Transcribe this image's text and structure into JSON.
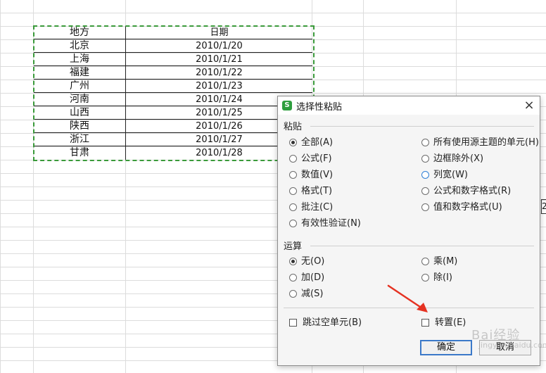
{
  "table": {
    "headers": [
      "地方",
      "日期"
    ],
    "rows": [
      [
        "北京",
        "2010/1/20"
      ],
      [
        "上海",
        "2010/1/21"
      ],
      [
        "福建",
        "2010/1/22"
      ],
      [
        "广州",
        "2010/1/23"
      ],
      [
        "河南",
        "2010/1/24"
      ],
      [
        "山西",
        "2010/1/25"
      ],
      [
        "陕西",
        "2010/1/26"
      ],
      [
        "浙江",
        "2010/1/27"
      ],
      [
        "甘肃",
        "2010/1/28"
      ]
    ]
  },
  "edge_cell": "2",
  "dialog": {
    "title": "选择性粘贴",
    "icon_letter": "S",
    "close": "×",
    "paste_section": "粘贴",
    "paste_left": [
      "全部(A)",
      "公式(F)",
      "数值(V)",
      "格式(T)",
      "批注(C)",
      "有效性验证(N)"
    ],
    "paste_right": [
      "所有使用源主题的单元(H)",
      "边框除外(X)",
      "列宽(W)",
      "公式和数字格式(R)",
      "值和数字格式(U)"
    ],
    "operation_section": "运算",
    "op_left": [
      "无(O)",
      "加(D)",
      "减(S)"
    ],
    "op_right": [
      "乘(M)",
      "除(I)"
    ],
    "skip_blanks": "跳过空单元(B)",
    "transpose": "转置(E)",
    "ok": "确定",
    "cancel": "取消",
    "selected_paste": "全部(A)",
    "selected_op": "无(O)"
  },
  "watermark": "Bai经验",
  "watermark_sub": "jingyan.baidu.com",
  "colors": {
    "marquee": "#3a9a3a",
    "accent": "#3b79c9",
    "arrow": "#e53222",
    "app_icon": "#2e9e3e"
  }
}
